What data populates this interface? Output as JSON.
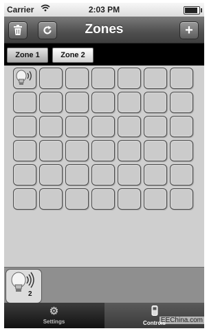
{
  "status_bar": {
    "carrier": "Carrier",
    "time": "2:03 PM"
  },
  "nav_bar": {
    "title": "Zones",
    "add_label": "+"
  },
  "tabs": [
    {
      "label": "Zone 1",
      "active": true
    },
    {
      "label": "Zone 2",
      "active": false
    }
  ],
  "grid": {
    "columns": 7,
    "rows": 6,
    "occupied_cell_icon": "light-bulb-icon"
  },
  "light_tile": {
    "icon": "light-bulb-icon",
    "count": "2"
  },
  "tab_bar": {
    "items": [
      {
        "label": "Settings",
        "icon": "gear-icon",
        "selected": false
      },
      {
        "label": "Controls",
        "icon": "remote-icon",
        "selected": true
      }
    ]
  },
  "watermark": "EEChina.com"
}
